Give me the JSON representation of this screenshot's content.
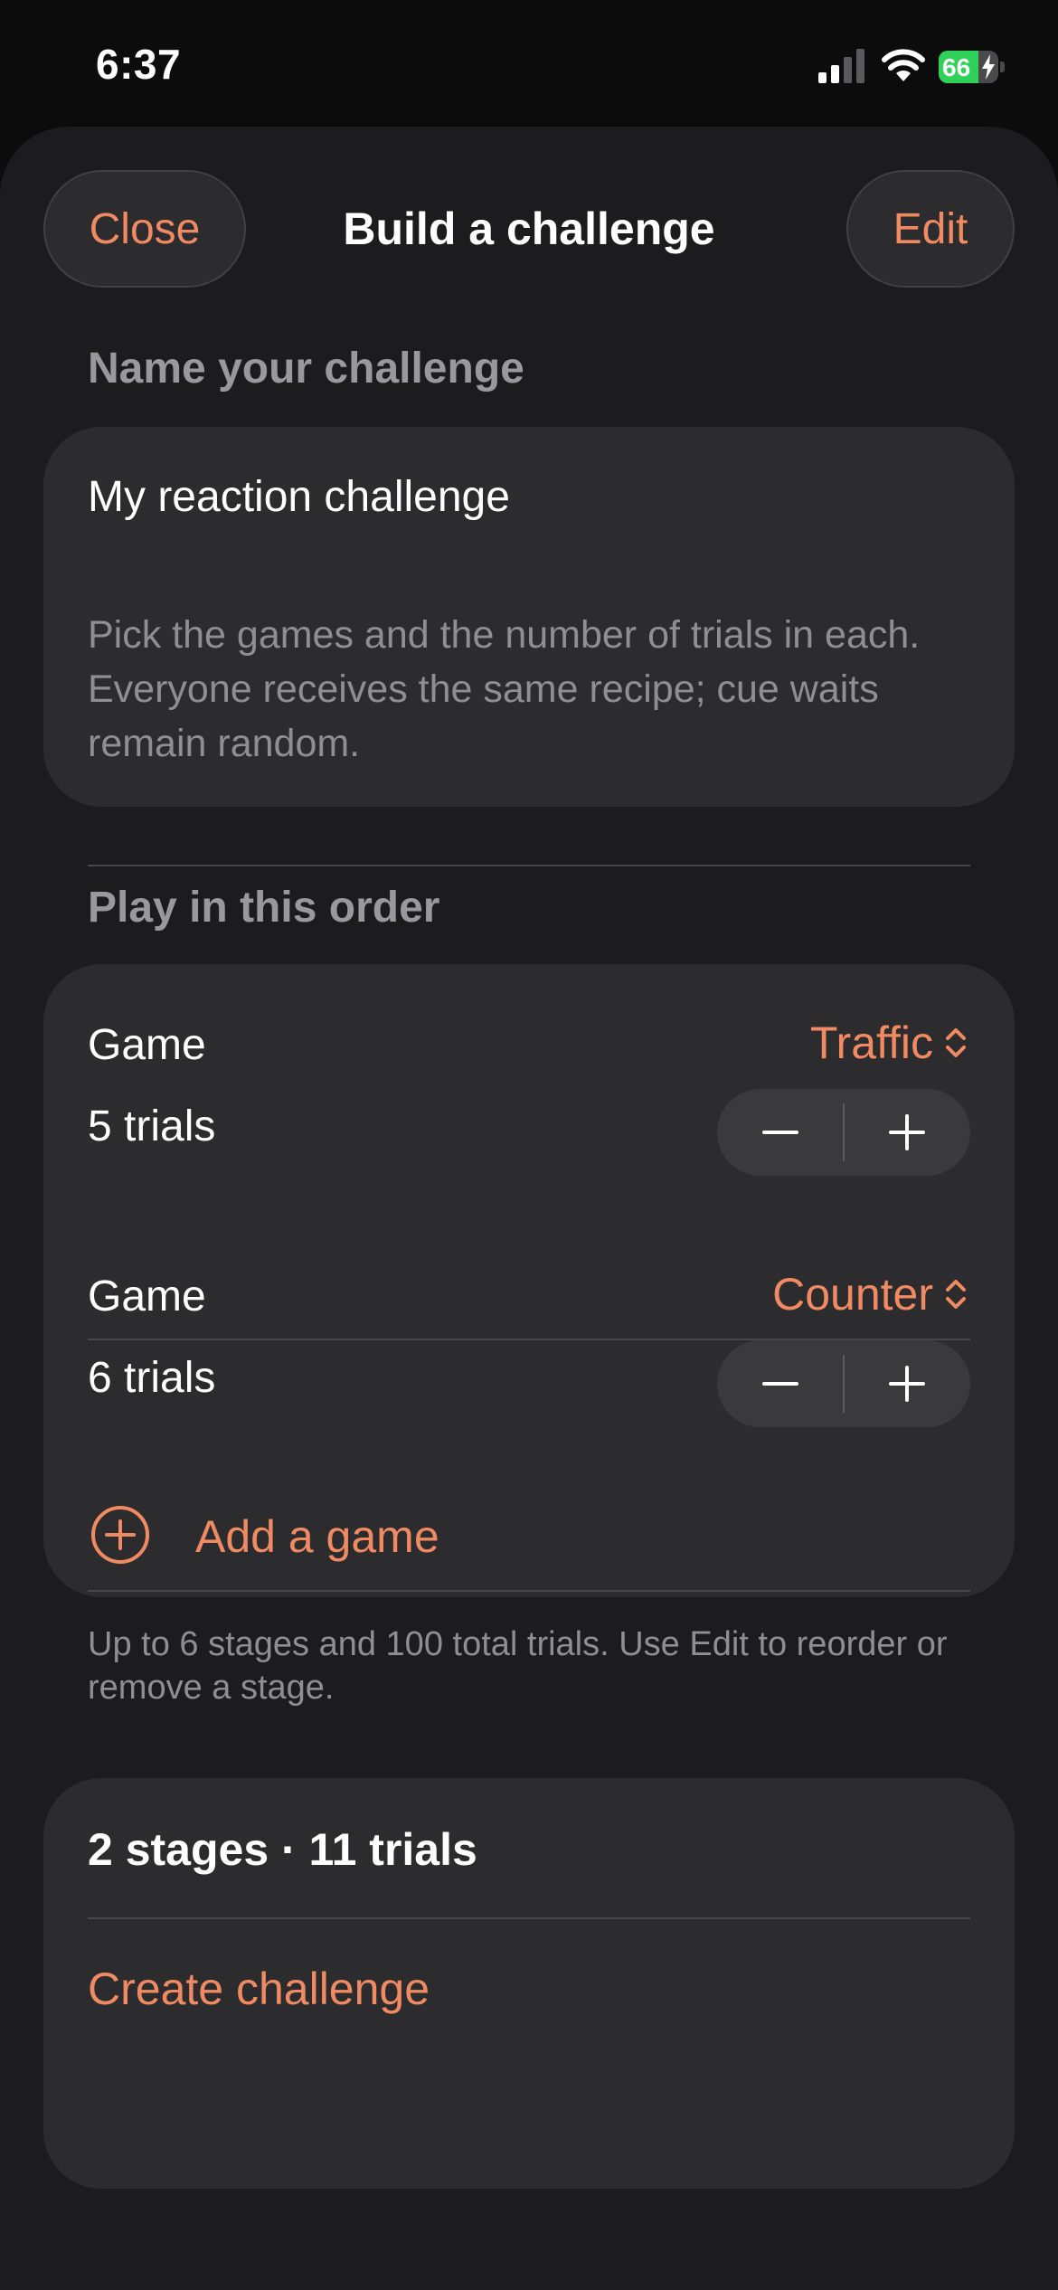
{
  "status_bar": {
    "time": "6:37",
    "battery_level": "66",
    "battery_percent": 66,
    "icons": [
      "cellular-signal-icon",
      "wifi-icon",
      "battery-charging-icon"
    ]
  },
  "header": {
    "close_label": "Close",
    "title": "Build a challenge",
    "edit_label": "Edit"
  },
  "name_section": {
    "header": "Name your challenge",
    "name_value": "My reaction challenge",
    "description": "Pick the games and the number of trials in each. Everyone receives the same recipe; cue waits remain random."
  },
  "order_section": {
    "header": "Play in this order",
    "stages": [
      {
        "game_label": "Game",
        "game_value": "Traffic",
        "trials_text": "5 trials"
      },
      {
        "game_label": "Game",
        "game_value": "Counter",
        "trials_text": "6 trials"
      }
    ],
    "add_label": "Add a game",
    "footnote": "Up to 6 stages and 100 total trials. Use Edit to reorder or remove a stage."
  },
  "summary": {
    "text": "2 stages · 11 trials",
    "create_label": "Create challenge"
  },
  "colors": {
    "accent": "#f08a63",
    "background": "#1c1c1e",
    "card": "#2c2c2e",
    "battery_green": "#30d158"
  }
}
